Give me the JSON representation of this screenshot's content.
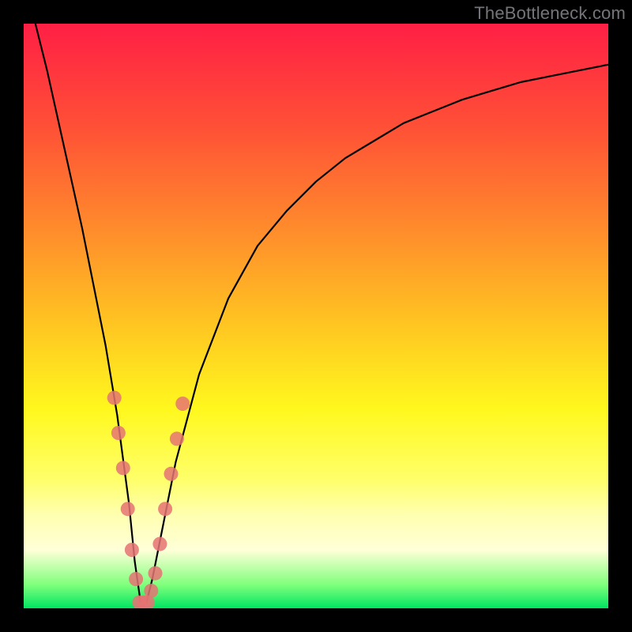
{
  "watermark": "TheBottleneck.com",
  "chart_data": {
    "type": "line",
    "title": "",
    "xlabel": "",
    "ylabel": "",
    "xlim": [
      0,
      100
    ],
    "ylim": [
      0,
      100
    ],
    "grid": false,
    "legend": false,
    "background_gradient": {
      "top": "#ff1f45",
      "mid": "#fff81e",
      "bottom": "#00e562"
    },
    "series": [
      {
        "name": "bottleneck-curve",
        "color": "#000000",
        "x": [
          2,
          4,
          6,
          8,
          10,
          12,
          14,
          16,
          18,
          19,
          20,
          21,
          22,
          24,
          26,
          30,
          35,
          40,
          45,
          50,
          55,
          60,
          65,
          70,
          75,
          80,
          85,
          90,
          95,
          100
        ],
        "y": [
          100,
          92,
          83,
          74,
          65,
          55,
          45,
          33,
          18,
          8,
          1,
          1,
          5,
          15,
          25,
          40,
          53,
          62,
          68,
          73,
          77,
          80,
          83,
          85,
          87,
          88.5,
          90,
          91,
          92,
          93
        ]
      }
    ],
    "markers": {
      "name": "highlight-dots",
      "color": "#e57373",
      "radius": 9,
      "points_x": [
        15.5,
        16.2,
        17.0,
        17.8,
        18.5,
        19.2,
        19.8,
        20.5,
        21.2,
        21.8,
        22.5,
        23.3,
        24.2,
        25.2,
        26.2,
        27.2
      ],
      "points_y": [
        36,
        30,
        24,
        17,
        10,
        5,
        1,
        1,
        1,
        3,
        6,
        11,
        17,
        23,
        29,
        35
      ]
    }
  }
}
